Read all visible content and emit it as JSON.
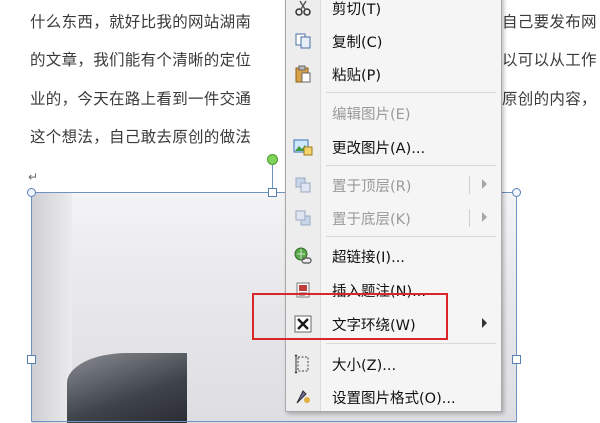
{
  "document": {
    "lines": [
      {
        "left": "什么东西，就好比我的网站湖南",
        "right": "自己要发布网"
      },
      {
        "left": "的文章，我们能有个清晰的定位",
        "right": "以可以从工作"
      },
      {
        "left": "业的，今天在路上看到一件交通",
        "right": "原创的内容，"
      },
      {
        "left": "这个想法，自己敢去原创的做法",
        "right": ""
      }
    ],
    "paragraph_mark": "↵"
  },
  "context_menu": {
    "items": [
      {
        "label": "剪切(T)",
        "icon": "scissors-icon",
        "enabled": true
      },
      {
        "label": "复制(C)",
        "icon": "copy-icon",
        "enabled": true
      },
      {
        "label": "粘贴(P)",
        "icon": "paste-icon",
        "enabled": true
      },
      {
        "label": "编辑图片(E)",
        "icon": "",
        "enabled": false
      },
      {
        "label": "更改图片(A)...",
        "icon": "change-picture-icon",
        "enabled": true
      },
      {
        "label": "置于顶层(R)",
        "icon": "bring-to-front-icon",
        "enabled": false,
        "submenu": true
      },
      {
        "label": "置于底层(K)",
        "icon": "send-to-back-icon",
        "enabled": false,
        "submenu": true
      },
      {
        "label": "超链接(I)...",
        "icon": "hyperlink-icon",
        "enabled": true
      },
      {
        "label": "插入题注(N)...",
        "icon": "insert-caption-icon",
        "enabled": true
      },
      {
        "label": "文字环绕(W)",
        "icon": "text-wrapping-icon",
        "enabled": true,
        "submenu": true
      },
      {
        "label": "大小(Z)...",
        "icon": "size-icon",
        "enabled": true
      },
      {
        "label": "设置图片格式(O)...",
        "icon": "format-picture-icon",
        "enabled": true
      }
    ]
  },
  "colors": {
    "menu_background": "#f5f5f5",
    "selection_handles": "#5a7fb5",
    "highlight_annotation": "#d8262b",
    "rotate_handle": "#7fd35a"
  }
}
